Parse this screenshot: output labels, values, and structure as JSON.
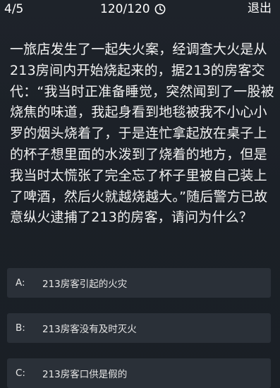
{
  "header": {
    "progress": "4/5",
    "timer": "120/120",
    "exit_label": "退出",
    "clock_icon": "clock-icon"
  },
  "question": {
    "text": "一旅店发生了一起失火案，经调查大火是从213房间内开始烧起来的，据213的房客交代：“我当时正准备睡觉，突然闻到了一股被烧焦的味道，我起身看到地毯被我不小心小罗的烟头烧着了，于是连忙拿起放在桌子上的杯子想里面的水泼到了烧着的地方，但是我当时太慌张了完全忘了杯子里被自己装上了啤酒，然后火就越烧越大。”随后警方已故意纵火逮捕了213的房客，请问为什么？"
  },
  "options": [
    {
      "letter": "A:",
      "text": "213房客引起的火灾"
    },
    {
      "letter": "B:",
      "text": "213房客没有及时灭火"
    },
    {
      "letter": "C:",
      "text": "213房客口供是假的"
    }
  ],
  "colors": {
    "background": "#1c2128",
    "option_background": "#2a3038",
    "text": "#ffffff"
  }
}
